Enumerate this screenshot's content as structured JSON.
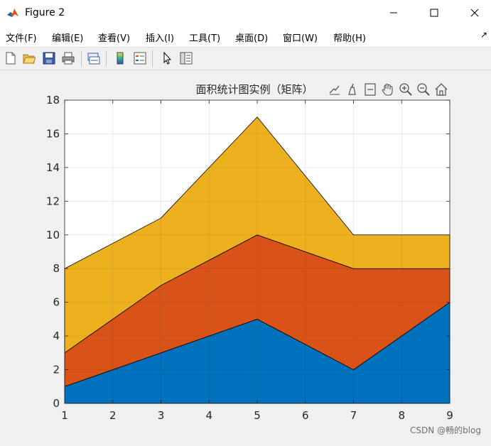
{
  "window": {
    "title": "Figure 2",
    "controls": {
      "minimize": "—",
      "maximize": "☐",
      "close": "✕"
    }
  },
  "menu": [
    {
      "label": "文件(F)"
    },
    {
      "label": "编辑(E)"
    },
    {
      "label": "查看(V)"
    },
    {
      "label": "插入(I)"
    },
    {
      "label": "工具(T)"
    },
    {
      "label": "桌面(D)"
    },
    {
      "label": "窗口(W)"
    },
    {
      "label": "帮助(H)"
    }
  ],
  "toolbar": {
    "buttons": [
      "new-figure-icon",
      "open-file-icon",
      "save-icon",
      "print-icon",
      "link-plot-icon",
      "insert-colorbar-icon",
      "insert-legend-icon",
      "edit-plot-arrow-icon",
      "property-inspector-icon"
    ]
  },
  "axes_toolbar": {
    "buttons": [
      "export-icon",
      "brush-icon",
      "data-tips-icon",
      "pan-hand-icon",
      "zoom-in-icon",
      "zoom-out-icon",
      "home-icon"
    ]
  },
  "chart_data": {
    "type": "area",
    "title": "面积统计图实例（矩阵）",
    "x": [
      1,
      3,
      5,
      7,
      9
    ],
    "series": [
      {
        "values": [
          1,
          3,
          5,
          2,
          6
        ],
        "color": "#0072BD"
      },
      {
        "values": [
          2,
          4,
          5,
          6,
          2
        ],
        "color": "#D95319"
      },
      {
        "values": [
          5,
          4,
          7,
          2,
          2
        ],
        "color": "#EDB120"
      }
    ],
    "stacked": true,
    "xlim": [
      1,
      9
    ],
    "ylim": [
      0,
      18
    ],
    "xticks": [
      1,
      2,
      3,
      4,
      5,
      6,
      7,
      8,
      9
    ],
    "yticks": [
      0,
      2,
      4,
      6,
      8,
      10,
      12,
      14,
      16,
      18
    ],
    "grid": true,
    "xlabel": "",
    "ylabel": ""
  },
  "watermark": "CSDN @畅的blog"
}
